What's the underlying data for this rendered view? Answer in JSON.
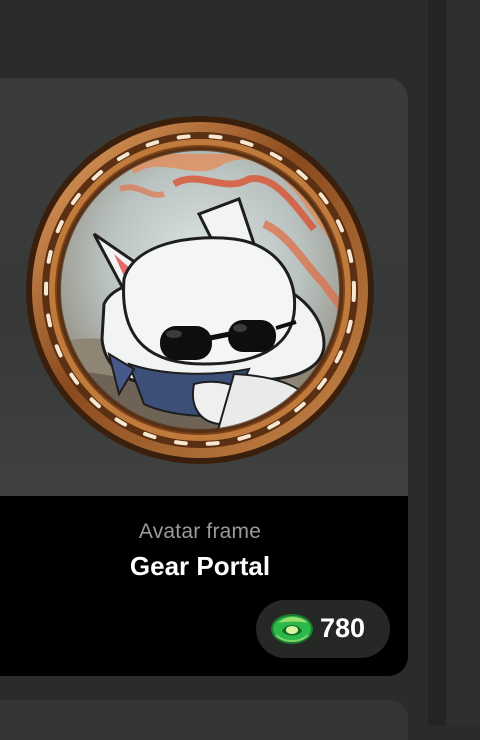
{
  "item": {
    "category": "Avatar frame",
    "name": "Gear Portal",
    "price": "780"
  },
  "icons": {
    "currency": "gem-coin-icon"
  },
  "colors": {
    "card_bottom": "#000000",
    "pill": "#262826",
    "frame_gold": "#b8733b"
  }
}
